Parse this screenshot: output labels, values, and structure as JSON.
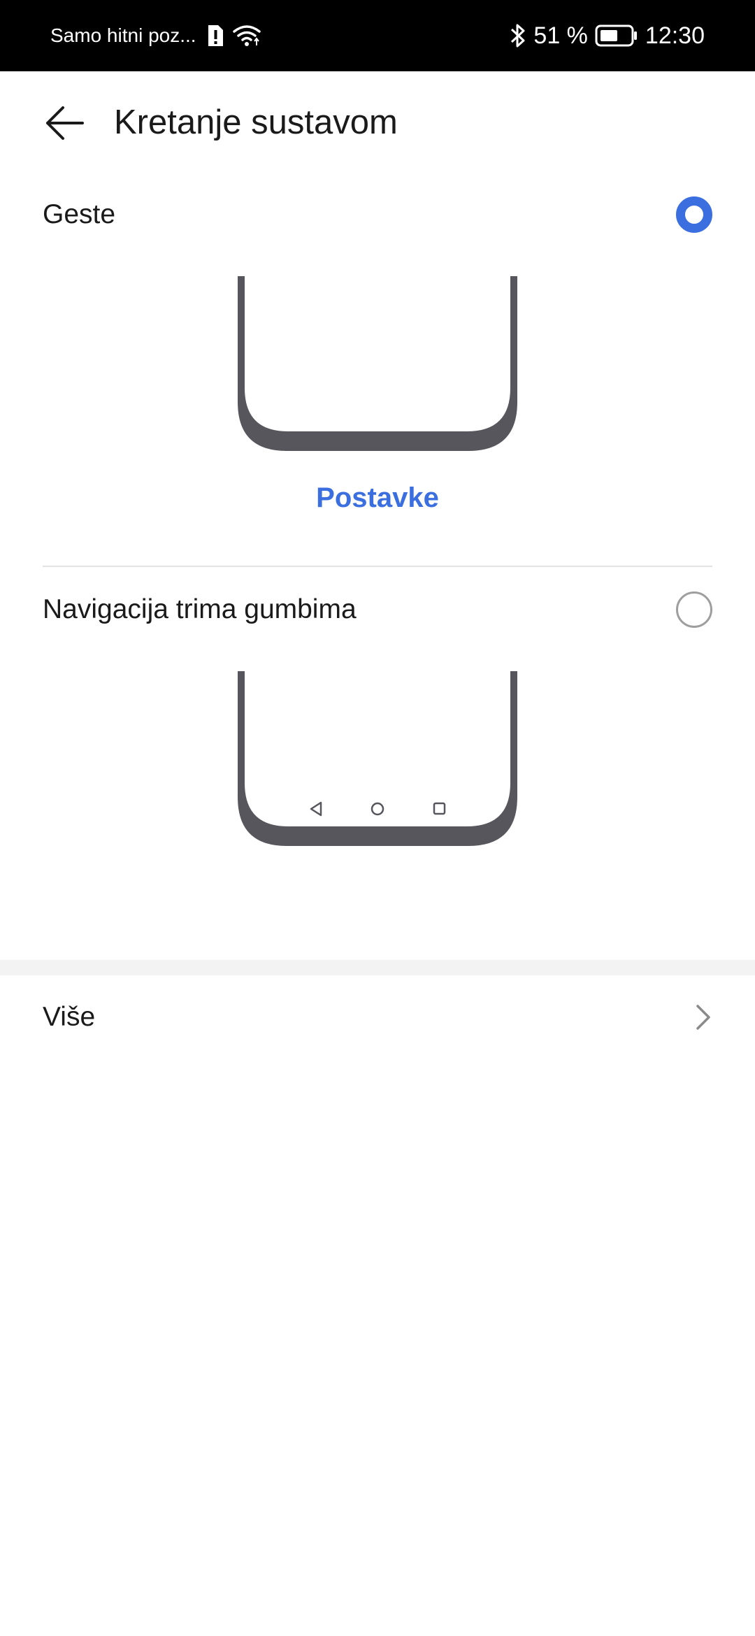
{
  "status_bar": {
    "carrier_text": "Samo hitni poz...",
    "battery_percent": "51 %",
    "time": "12:30",
    "icons": [
      "sim-alert-icon",
      "wifi-icon",
      "bluetooth-icon",
      "battery-icon"
    ]
  },
  "header": {
    "title": "Kretanje sustavom",
    "back_icon": "back-arrow-icon"
  },
  "options": [
    {
      "label": "Geste",
      "selected": true,
      "settings_label": "Postavke"
    },
    {
      "label": "Navigacija trima gumbima",
      "selected": false,
      "nav_icons": [
        "back-triangle-icon",
        "home-circle-icon",
        "recents-square-icon"
      ]
    }
  ],
  "more": {
    "label": "Više",
    "icon": "chevron-right-icon"
  },
  "colors": {
    "accent": "#3b6fe0",
    "status_bar_bg": "#000000",
    "phone_frame": "#56565c"
  }
}
